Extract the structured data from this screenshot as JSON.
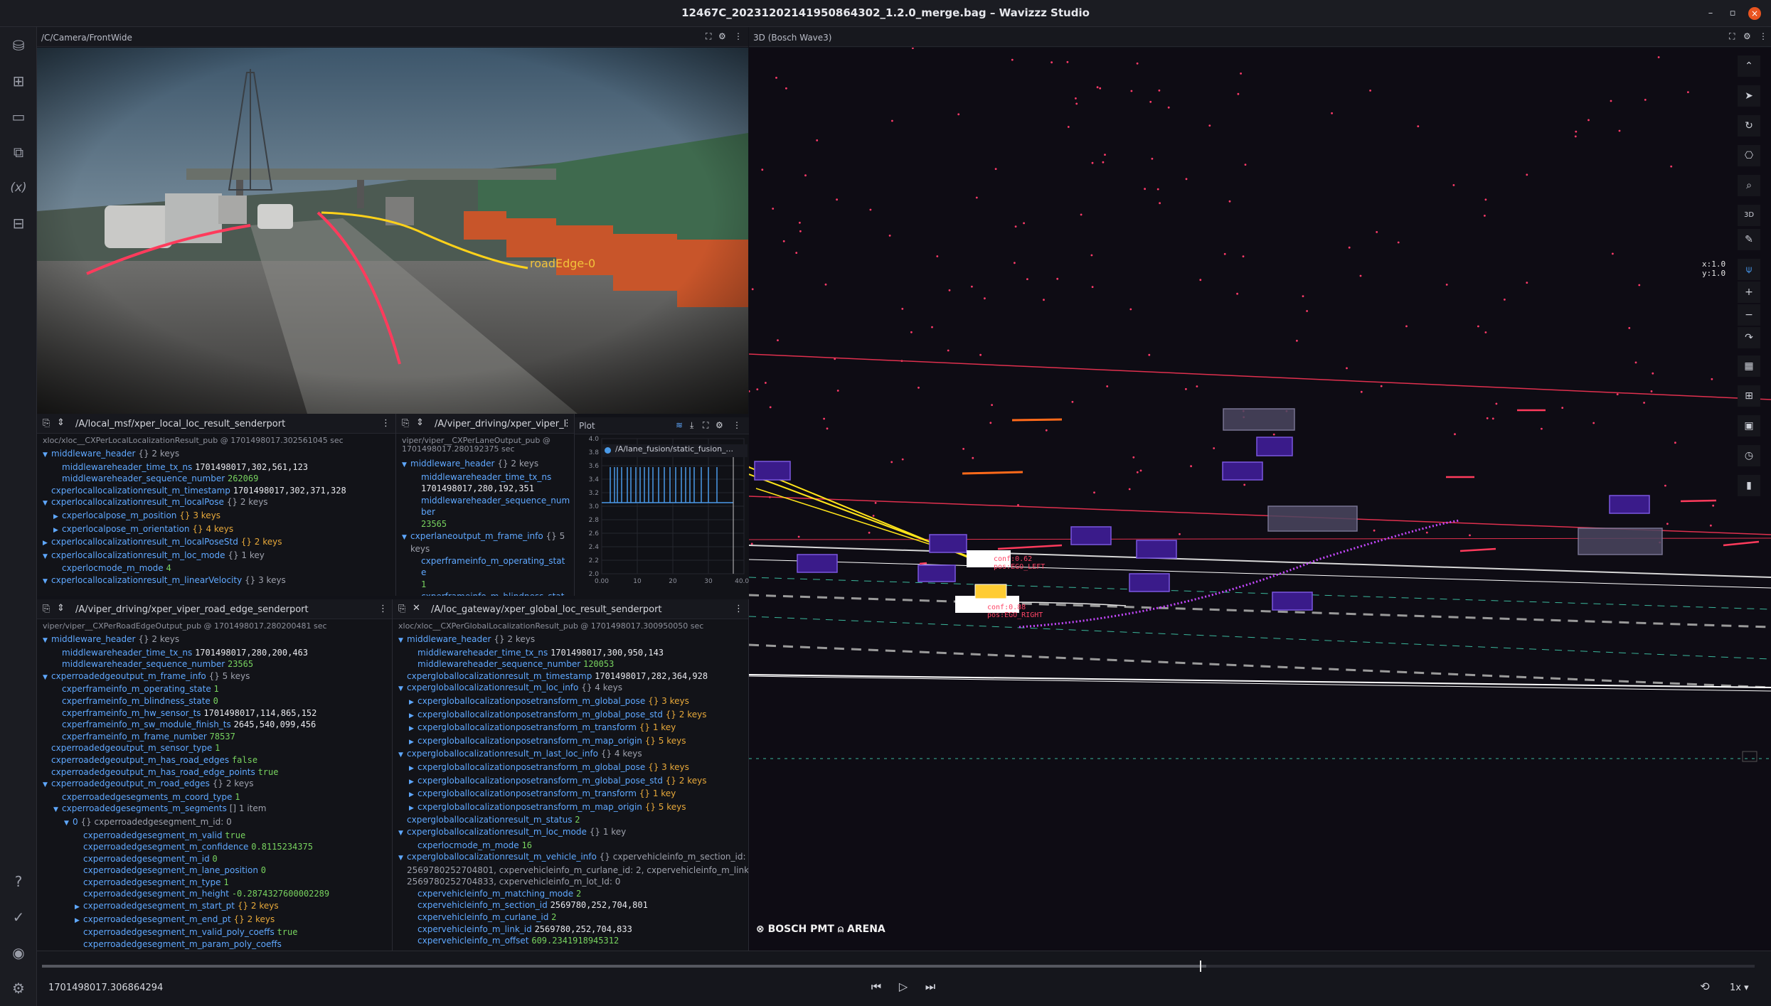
{
  "window": {
    "title": "12467C_20231202141950864302_1.2.0_merge.bag – Wavizzz Studio",
    "min": "–",
    "restore": "▫",
    "close": "×"
  },
  "panels": {
    "camera": {
      "title": "/C/Camera/FrontWide",
      "label": "roadEdge-0"
    },
    "scene": {
      "title": "3D (Bosch Wave3)",
      "scale_x": "x:1.0",
      "scale_y": "y:1.0",
      "brand": "BOSCH PMT",
      "brand2": "ARENA",
      "boxes": [
        {
          "label": "conf:0.62",
          "pos": "pos:EGO_LEFT"
        },
        {
          "label": "conf:0.88",
          "pos": "pos:EGO_RIGHT"
        }
      ]
    },
    "plot": {
      "title": "Plot",
      "series": "/A/lane_fusion/static_fusion_...",
      "yticks": [
        "4.0",
        "3.8",
        "3.6",
        "3.4",
        "3.2",
        "3.0",
        "2.8",
        "2.6",
        "2.4",
        "2.2",
        "2.0"
      ],
      "xticks": [
        "0.00",
        "10",
        "20",
        "30",
        "40.00"
      ]
    },
    "local_loc": {
      "title": "/A/local_msf/xper_local_loc_result_senderport",
      "sub": "xloc/xloc__CXPerLocalLocalizationResult_pub @ 1701498017.302561045 sec"
    },
    "lane": {
      "title": "/A/viper_driving/xper_viper_l",
      "sub": "viper/viper__CXPerLaneOutput_pub @",
      "sub2": "1701498017.280192375 sec"
    },
    "road_edge": {
      "title": "/A/viper_driving/xper_viper_road_edge_senderport",
      "sub": "viper/viper__CXPerRoadEdgeOutput_pub @ 1701498017.280200481 sec"
    },
    "global_loc": {
      "title": "/A/loc_gateway/xper_global_loc_result_senderport",
      "sub": "xloc/xloc__CXPerGlobalLocalizationResult_pub @ 1701498017.300950050 sec"
    }
  },
  "trees": {
    "local_loc": [
      {
        "i": 0,
        "t": "▼",
        "k": "middleware_header",
        "m": "{} 2 keys"
      },
      {
        "i": 1,
        "k": "middlewareheader_time_tx_ns",
        "v": "1701498017,302,561,123"
      },
      {
        "i": 1,
        "k": "middlewareheader_sequence_number",
        "v": "262069",
        "c": "g"
      },
      {
        "i": 0,
        "k": "cxperlocallocalizationresult_m_timestamp",
        "v": "1701498017,302,371,328"
      },
      {
        "i": 0,
        "t": "▼",
        "k": "cxperlocallocalizationresult_m_localPose",
        "m": "{} 2 keys"
      },
      {
        "i": 1,
        "t": "▶",
        "k": "cxperlocalpose_m_position",
        "m": "{} 3 keys",
        "mc": "y"
      },
      {
        "i": 1,
        "t": "▶",
        "k": "cxperlocalpose_m_orientation",
        "m": "{} 4 keys",
        "mc": "y"
      },
      {
        "i": 0,
        "t": "▶",
        "k": "cxperlocallocalizationresult_m_localPoseStd",
        "m": "{} 2 keys",
        "mc": "y"
      },
      {
        "i": 0,
        "t": "▼",
        "k": "cxperlocallocalizationresult_m_loc_mode",
        "m": "{} 1 key"
      },
      {
        "i": 1,
        "k": "cxperlocmode_m_mode",
        "v": "4",
        "c": "g"
      },
      {
        "i": 0,
        "t": "▼",
        "k": "cxperlocallocalizationresult_m_linearVelocity",
        "m": "{} 3 keys"
      }
    ],
    "lane": [
      {
        "i": 0,
        "t": "▼",
        "k": "middleware_header",
        "m": "{} 2 keys"
      },
      {
        "i": 1,
        "k": "middlewareheader_time_tx_ns",
        "v": ""
      },
      {
        "i": 1,
        "k": "",
        "v": "1701498017,280,192,351"
      },
      {
        "i": 1,
        "k": "middlewareheader_sequence_num",
        "v": ""
      },
      {
        "i": 1,
        "k": "ber",
        "v": ""
      },
      {
        "i": 1,
        "k": "",
        "v": "23565",
        "c": "g"
      },
      {
        "i": 0,
        "t": "▼",
        "k": "cxperlaneoutput_m_frame_info",
        "m": "{} 5"
      },
      {
        "i": 0,
        "k": "",
        "m": "keys"
      },
      {
        "i": 1,
        "k": "cxperframeinfo_m_operating_stat",
        "v": ""
      },
      {
        "i": 1,
        "k": "e",
        "v": ""
      },
      {
        "i": 1,
        "k": "",
        "v": "1",
        "c": "g"
      },
      {
        "i": 1,
        "k": "cxperframeinfo_m_blindness_stat",
        "v": ""
      },
      {
        "i": 1,
        "k": "e",
        "v": ""
      }
    ],
    "road_edge": [
      {
        "i": 0,
        "t": "▼",
        "k": "middleware_header",
        "m": "{} 2 keys"
      },
      {
        "i": 1,
        "k": "middlewareheader_time_tx_ns",
        "v": "1701498017,280,200,463"
      },
      {
        "i": 1,
        "k": "middlewareheader_sequence_number",
        "v": "23565",
        "c": "g"
      },
      {
        "i": 0,
        "t": "▼",
        "k": "cxperroadedgeoutput_m_frame_info",
        "m": "{} 5 keys"
      },
      {
        "i": 1,
        "k": "cxperframeinfo_m_operating_state",
        "v": "1",
        "c": "g"
      },
      {
        "i": 1,
        "k": "cxperframeinfo_m_blindness_state",
        "v": "0",
        "c": "g"
      },
      {
        "i": 1,
        "k": "cxperframeinfo_m_hw_sensor_ts",
        "v": "1701498017,114,865,152"
      },
      {
        "i": 1,
        "k": "cxperframeinfo_m_sw_module_finish_ts",
        "v": "2645,540,099,456"
      },
      {
        "i": 1,
        "k": "cxperframeinfo_m_frame_number",
        "v": "78537",
        "c": "g"
      },
      {
        "i": 0,
        "k": "cxperroadedgeoutput_m_sensor_type",
        "v": "1",
        "c": "g"
      },
      {
        "i": 0,
        "k": "cxperroadedgeoutput_m_has_road_edges",
        "v": "false",
        "c": "g"
      },
      {
        "i": 0,
        "k": "cxperroadedgeoutput_m_has_road_edge_points",
        "v": "true",
        "c": "g"
      },
      {
        "i": 0,
        "t": "▼",
        "k": "cxperroadedgeoutput_m_road_edges",
        "m": "{} 2 keys"
      },
      {
        "i": 1,
        "k": "cxperroadedgesegments_m_coord_type",
        "v": "1",
        "c": "g"
      },
      {
        "i": 1,
        "t": "▼",
        "k": "cxperroadedgesegments_m_segments",
        "m": "[] 1 item"
      },
      {
        "i": 2,
        "t": "▼",
        "k": "0",
        "m": "{} cxperroadedgesegment_m_id: 0"
      },
      {
        "i": 3,
        "k": "cxperroadedgesegment_m_valid",
        "v": "true",
        "c": "g"
      },
      {
        "i": 3,
        "k": "cxperroadedgesegment_m_confidence",
        "v": "0.8115234375",
        "c": "g"
      },
      {
        "i": 3,
        "k": "cxperroadedgesegment_m_id",
        "v": "0",
        "c": "g"
      },
      {
        "i": 3,
        "k": "cxperroadedgesegment_m_lane_position",
        "v": "0",
        "c": "g"
      },
      {
        "i": 3,
        "k": "cxperroadedgesegment_m_type",
        "v": "1",
        "c": "g"
      },
      {
        "i": 3,
        "k": "cxperroadedgesegment_m_height",
        "v": "-0.2874327600002289",
        "c": "g"
      },
      {
        "i": 3,
        "t": "▶",
        "k": "cxperroadedgesegment_m_start_pt",
        "m": "{} 2 keys",
        "mc": "y"
      },
      {
        "i": 3,
        "t": "▶",
        "k": "cxperroadedgesegment_m_end_pt",
        "m": "{} 2 keys",
        "mc": "y"
      },
      {
        "i": 3,
        "k": "cxperroadedgesegment_m_valid_poly_coeffs",
        "v": "true",
        "c": "g"
      },
      {
        "i": 3,
        "k": "cxperroadedgesegment_m_param_poly_coeffs",
        "v": ""
      }
    ],
    "global_loc": [
      {
        "i": 0,
        "t": "▼",
        "k": "middleware_header",
        "m": "{} 2 keys"
      },
      {
        "i": 1,
        "k": "middlewareheader_time_tx_ns",
        "v": "1701498017,300,950,143"
      },
      {
        "i": 1,
        "k": "middlewareheader_sequence_number",
        "v": "120053",
        "c": "g"
      },
      {
        "i": 0,
        "k": "cxpergloballocalizationresult_m_timestamp",
        "v": "1701498017,282,364,928"
      },
      {
        "i": 0,
        "t": "▼",
        "k": "cxpergloballocalizationresult_m_loc_info",
        "m": "{} 4 keys"
      },
      {
        "i": 1,
        "t": "▶",
        "k": "cxpergloballocalizationposetransform_m_global_pose",
        "m": "{} 3 keys",
        "mc": "y"
      },
      {
        "i": 1,
        "t": "▶",
        "k": "cxpergloballocalizationposetransform_m_global_pose_std",
        "m": "{} 2 keys",
        "mc": "y"
      },
      {
        "i": 1,
        "t": "▶",
        "k": "cxpergloballocalizationposetransform_m_transform",
        "m": "{} 1 key",
        "mc": "y"
      },
      {
        "i": 1,
        "t": "▶",
        "k": "cxpergloballocalizationposetransform_m_map_origin",
        "m": "{} 5 keys",
        "mc": "y"
      },
      {
        "i": 0,
        "t": "▼",
        "k": "cxpergloballocalizationresult_m_last_loc_info",
        "m": "{} 4 keys"
      },
      {
        "i": 1,
        "t": "▶",
        "k": "cxpergloballocalizationposetransform_m_global_pose",
        "m": "{} 3 keys",
        "mc": "y"
      },
      {
        "i": 1,
        "t": "▶",
        "k": "cxpergloballocalizationposetransform_m_global_pose_std",
        "m": "{} 2 keys",
        "mc": "y"
      },
      {
        "i": 1,
        "t": "▶",
        "k": "cxpergloballocalizationposetransform_m_transform",
        "m": "{} 1 key",
        "mc": "y"
      },
      {
        "i": 1,
        "t": "▶",
        "k": "cxpergloballocalizationposetransform_m_map_origin",
        "m": "{} 5 keys",
        "mc": "y"
      },
      {
        "i": 0,
        "k": "cxpergloballocalizationresult_m_status",
        "v": "2",
        "c": "g"
      },
      {
        "i": 0,
        "t": "▼",
        "k": "cxpergloballocalizationresult_m_loc_mode",
        "m": "{} 1 key"
      },
      {
        "i": 1,
        "k": "cxperlocmode_m_mode",
        "v": "16",
        "c": "g"
      },
      {
        "i": 0,
        "t": "▼",
        "k": "cxpergloballocalizationresult_m_vehicle_info",
        "m": "{} cxpervehicleinfo_m_section_id:"
      },
      {
        "i": 0,
        "k": "",
        "m": "2569780252704801, cxpervehicleinfo_m_curlane_id: 2, cxpervehicleinfo_m_link_id:"
      },
      {
        "i": 0,
        "k": "",
        "m": "2569780252704833, cxpervehicleinfo_m_lot_Id: 0"
      },
      {
        "i": 1,
        "k": "cxpervehicleinfo_m_matching_mode",
        "v": "2",
        "c": "g"
      },
      {
        "i": 1,
        "k": "cxpervehicleinfo_m_section_id",
        "v": "2569780,252,704,801"
      },
      {
        "i": 1,
        "k": "cxpervehicleinfo_m_curlane_id",
        "v": "2",
        "c": "g"
      },
      {
        "i": 1,
        "k": "cxpervehicleinfo_m_link_id",
        "v": "2569780,252,704,833"
      },
      {
        "i": 1,
        "k": "cxpervehicleinfo_m_offset",
        "v": "609.2341918945312",
        "c": "g"
      }
    ]
  },
  "playback": {
    "timestamp": "1701498017.306864294",
    "speed": "1x",
    "progress": 0.68
  },
  "colors": {
    "accent": "#5fa8ff",
    "green": "#78d35f",
    "orange": "#e8a93a",
    "laneRed": "#ff3b5c",
    "purple": "#5b2bb5"
  }
}
